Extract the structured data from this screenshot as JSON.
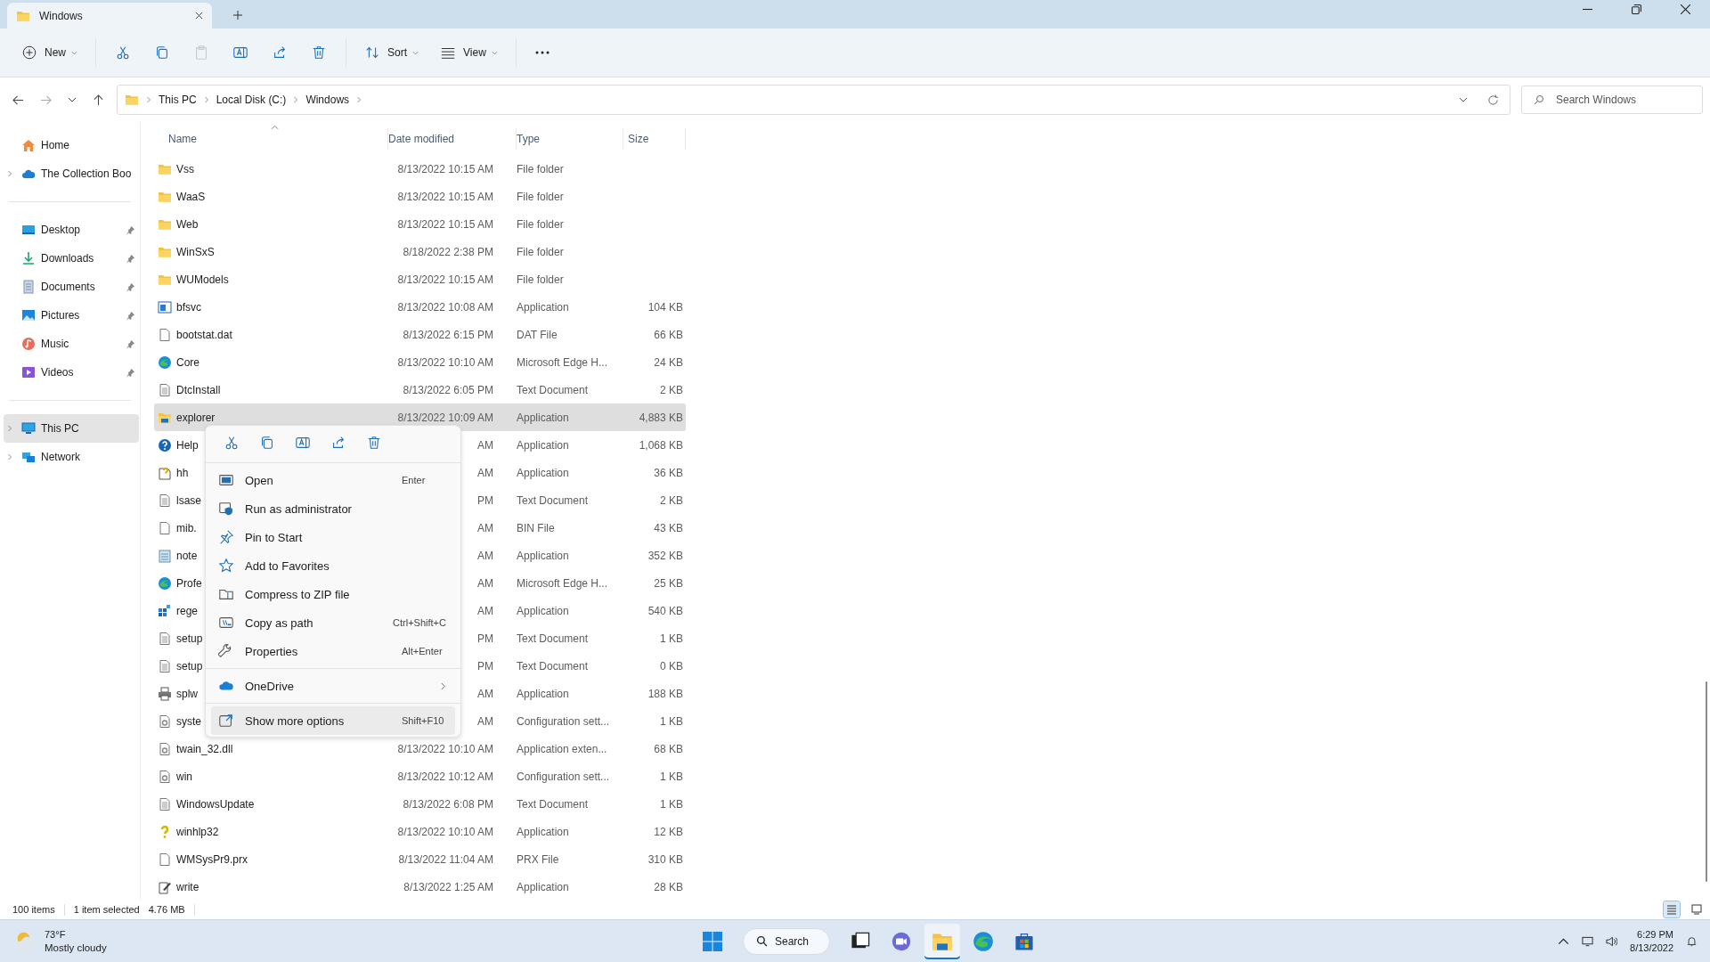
{
  "window": {
    "tab_title": "Windows"
  },
  "toolbar": {
    "new_label": "New",
    "actions": [
      {
        "disabled": false
      },
      {
        "disabled": false
      },
      {
        "disabled": true
      },
      {
        "disabled": false
      },
      {
        "disabled": false
      },
      {
        "disabled": false
      }
    ],
    "sort_label": "Sort",
    "view_label": "View"
  },
  "address_bar": {
    "forward_disabled": true,
    "breadcrumbs": [
      "This PC",
      "Local Disk (C:)",
      "Windows"
    ]
  },
  "search": {
    "placeholder": "Search Windows"
  },
  "sidebar": {
    "groups": [
      [
        {
          "label": "Home",
          "expandable": false,
          "pinned": false,
          "selected": false
        },
        {
          "label": "The Collection Boo",
          "expandable": true,
          "pinned": false,
          "selected": false
        }
      ],
      [
        {
          "label": "Desktop",
          "expandable": false,
          "pinned": true,
          "selected": false
        },
        {
          "label": "Downloads",
          "expandable": false,
          "pinned": true,
          "selected": false
        },
        {
          "label": "Documents",
          "expandable": false,
          "pinned": true,
          "selected": false
        },
        {
          "label": "Pictures",
          "expandable": false,
          "pinned": true,
          "selected": false
        },
        {
          "label": "Music",
          "expandable": false,
          "pinned": true,
          "selected": false
        },
        {
          "label": "Videos",
          "expandable": false,
          "pinned": true,
          "selected": false
        }
      ],
      [
        {
          "label": "This PC",
          "expandable": true,
          "pinned": false,
          "selected": true
        },
        {
          "label": "Network",
          "expandable": true,
          "pinned": false,
          "selected": false
        }
      ]
    ]
  },
  "table": {
    "columns": [
      "Name",
      "Date modified",
      "Type",
      "Size"
    ],
    "rows": [
      {
        "kind": "folder",
        "name": "Vss",
        "date": "8/13/2022 10:15 AM",
        "type": "File folder",
        "selected": false
      },
      {
        "kind": "folder",
        "name": "WaaS",
        "date": "8/13/2022 10:15 AM",
        "type": "File folder",
        "selected": false
      },
      {
        "kind": "folder",
        "name": "Web",
        "date": "8/13/2022 10:15 AM",
        "type": "File folder",
        "selected": false
      },
      {
        "kind": "folder",
        "name": "WinSxS",
        "date": "8/18/2022 2:38 PM",
        "type": "File folder",
        "selected": false
      },
      {
        "kind": "folder",
        "name": "WUModels",
        "date": "8/13/2022 10:15 AM",
        "type": "File folder",
        "selected": false
      },
      {
        "kind": "program",
        "name": "bfsvc",
        "date": "8/13/2022 10:08 AM",
        "type": "Application",
        "size": "104 KB",
        "selected": false
      },
      {
        "kind": "file",
        "name": "bootstat.dat",
        "date": "8/13/2022 6:15 PM",
        "type": "DAT File",
        "size": "66 KB",
        "selected": false
      },
      {
        "kind": "webpage",
        "name": "Core",
        "date": "8/13/2022 10:10 AM",
        "type": "Microsoft Edge H...",
        "size": "24 KB",
        "selected": false
      },
      {
        "kind": "textfile",
        "name": "DtcInstall",
        "date": "8/13/2022 6:05 PM",
        "type": "Text Document",
        "size": "2 KB",
        "selected": false
      },
      {
        "kind": "explorer",
        "name": "explorer",
        "date": "8/13/2022 10:09 AM",
        "type": "Application",
        "size": "4,883 KB",
        "selected": true
      },
      {
        "kind": "help",
        "name": "Help",
        "date": "AM",
        "type": "Application",
        "size": "1,068 KB",
        "selected": false
      },
      {
        "kind": "helpfile",
        "name": "hh",
        "date": "AM",
        "type": "Application",
        "size": "36 KB",
        "selected": false
      },
      {
        "kind": "textfile",
        "name": "lsase",
        "date": "PM",
        "type": "Text Document",
        "size": "2 KB",
        "selected": false
      },
      {
        "kind": "file",
        "name": "mib.",
        "date": "AM",
        "type": "BIN File",
        "size": "43 KB",
        "selected": false
      },
      {
        "kind": "notepad",
        "name": "note",
        "date": "AM",
        "type": "Application",
        "size": "352 KB",
        "selected": false
      },
      {
        "kind": "webpage",
        "name": "Profe",
        "date": "AM",
        "type": "Microsoft Edge H...",
        "size": "25 KB",
        "selected": false
      },
      {
        "kind": "registry",
        "name": "rege",
        "date": "AM",
        "type": "Application",
        "size": "540 KB",
        "selected": false
      },
      {
        "kind": "textfile",
        "name": "setup",
        "date": "PM",
        "type": "Text Document",
        "size": "1 KB",
        "selected": false
      },
      {
        "kind": "textfile",
        "name": "setup",
        "date": "PM",
        "type": "Text Document",
        "size": "0 KB",
        "selected": false
      },
      {
        "kind": "printer",
        "name": "splw",
        "date": "AM",
        "type": "Application",
        "size": "188 KB",
        "selected": false
      },
      {
        "kind": "settings",
        "name": "syste",
        "date": "AM",
        "type": "Configuration sett...",
        "size": "1 KB",
        "selected": false
      },
      {
        "kind": "settings",
        "name": "twain_32.dll",
        "date": "8/13/2022 10:10 AM",
        "type": "Application exten...",
        "size": "68 KB",
        "selected": false
      },
      {
        "kind": "settings",
        "name": "win",
        "date": "8/13/2022 10:12 AM",
        "type": "Configuration sett...",
        "size": "1 KB",
        "selected": false
      },
      {
        "kind": "textfile",
        "name": "WindowsUpdate",
        "date": "8/13/2022 6:08 PM",
        "type": "Text Document",
        "size": "1 KB",
        "selected": false
      },
      {
        "kind": "helper",
        "name": "winhlp32",
        "date": "8/13/2022 10:10 AM",
        "type": "Application",
        "size": "12 KB",
        "selected": false
      },
      {
        "kind": "file",
        "name": "WMSysPr9.prx",
        "date": "8/13/2022 11:04 AM",
        "type": "PRX File",
        "size": "310 KB",
        "selected": false
      },
      {
        "kind": "wordpad",
        "name": "write",
        "date": "8/13/2022 1:25 AM",
        "type": "Application",
        "size": "28 KB",
        "selected": false
      }
    ]
  },
  "context_menu": {
    "groups": [
      [
        {
          "label": "Open",
          "shortcut": "Enter",
          "submenu": false,
          "selected": false
        },
        {
          "label": "Run as administrator",
          "submenu": false,
          "selected": false
        },
        {
          "label": "Pin to Start",
          "submenu": false,
          "selected": false
        },
        {
          "label": "Add to Favorites",
          "submenu": false,
          "selected": false
        },
        {
          "label": "Compress to ZIP file",
          "submenu": false,
          "selected": false
        },
        {
          "label": "Copy as path",
          "shortcut": "Ctrl+Shift+C",
          "submenu": false,
          "selected": false
        },
        {
          "label": "Properties",
          "shortcut": "Alt+Enter",
          "submenu": false,
          "selected": false
        }
      ],
      [
        {
          "label": "OneDrive",
          "submenu": true,
          "selected": false
        }
      ],
      [
        {
          "label": "Show more options",
          "shortcut": "Shift+F10",
          "submenu": false,
          "selected": true
        }
      ]
    ]
  },
  "status_bar": {
    "item_count": "100 items",
    "selection": "1 item selected",
    "selection_size": "4.76 MB",
    "details_view": true
  },
  "taskbar": {
    "temperature": "73°F",
    "weather": "Mostly cloudy",
    "search_label": "Search",
    "apps": [
      {
        "active": false
      },
      {
        "active": false
      },
      {
        "active": true
      },
      {
        "active": false
      },
      {
        "active": false
      }
    ],
    "time": "6:29 PM",
    "date": "8/13/2022"
  }
}
